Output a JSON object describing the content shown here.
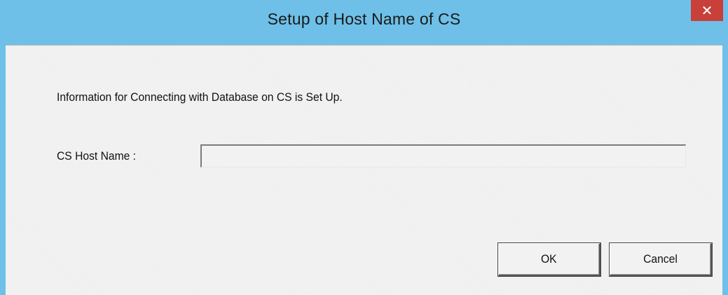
{
  "window": {
    "title": "Setup of Host Name of CS",
    "close_symbol": "✕"
  },
  "content": {
    "info_text": "Information for Connecting with Database on CS is Set Up.",
    "host_label": "CS Host Name :",
    "host_value": "",
    "host_placeholder": ""
  },
  "buttons": {
    "ok": "OK",
    "cancel": "Cancel"
  },
  "colors": {
    "titlebar": "#6ec0e8",
    "close_button": "#c9403a",
    "client_background": "#efefef"
  },
  "icons": {
    "close": "close-icon"
  }
}
